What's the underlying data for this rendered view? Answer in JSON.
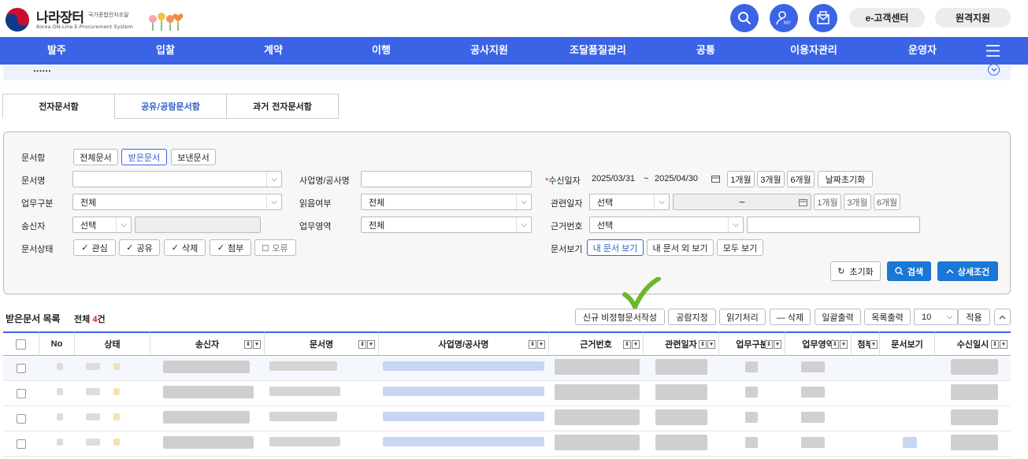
{
  "brand": {
    "title": "나라장터",
    "sub": "국가종합전자조달",
    "en": "Korea ON-Line E-Procurement System"
  },
  "header": {
    "cs_label": "e-고객센터",
    "remote_label": "원격지원"
  },
  "nav": [
    "발주",
    "입찰",
    "계약",
    "이행",
    "공사지원",
    "조달품질관리",
    "공통",
    "이용자관리",
    "운영자"
  ],
  "strip_text": "......",
  "tabs": [
    "전자문서함",
    "공유/공람문서함",
    "과거 전자문서함"
  ],
  "search": {
    "box_label": "문서함",
    "box_options": [
      "전체문서",
      "받은문서",
      "보낸문서"
    ],
    "doc_name_label": "문서명",
    "project_label": "사업명/공사명",
    "recv_date_label": "수신일자",
    "recv_from": "2025/03/31",
    "recv_tilde": "~",
    "recv_to": "2025/04/30",
    "m1": "1개월",
    "m3": "3개월",
    "m6": "6개월",
    "reset_date": "날짜초기화",
    "biz_label": "업무구분",
    "biz_value": "전체",
    "read_label": "읽음여부",
    "read_value": "전체",
    "rel_date_label": "관련일자",
    "rel_value": "선택",
    "rel_tilde": "~",
    "sender_label": "송신자",
    "sender_value": "선택",
    "area_label": "업무영역",
    "area_value": "전체",
    "ref_label": "근거번호",
    "ref_value": "선택",
    "status_label": "문서상태",
    "status_options": [
      "관심",
      "공유",
      "삭제",
      "첨부",
      "오류"
    ],
    "view_label": "문서보기",
    "view_options": [
      "내 문서 보기",
      "내 문서 외 보기",
      "모두 보기"
    ],
    "reset_label": "초기화",
    "search_label": "검색",
    "detail_label": "상세조건"
  },
  "list": {
    "title": "받은문서 목록",
    "total_prefix": "전체",
    "total_count": "4",
    "total_suffix": "건",
    "actions": [
      "신규 비정형문서작성",
      "공람지정",
      "읽기처리",
      "— 삭제",
      "일괄출력",
      "목록출력"
    ],
    "page_size": "10",
    "apply_label": "적용",
    "columns": [
      "No",
      "상태",
      "송신자",
      "문서명",
      "사업명/공사명",
      "근거번호",
      "관련일자",
      "업무구분",
      "업무영역",
      "첨부",
      "문서보기",
      "수신일시"
    ]
  },
  "colors": {
    "nav": "#3a63e6",
    "search_btn": "#1b77d6",
    "checkmark": "#6ab82e",
    "count": "#d21f1f"
  }
}
